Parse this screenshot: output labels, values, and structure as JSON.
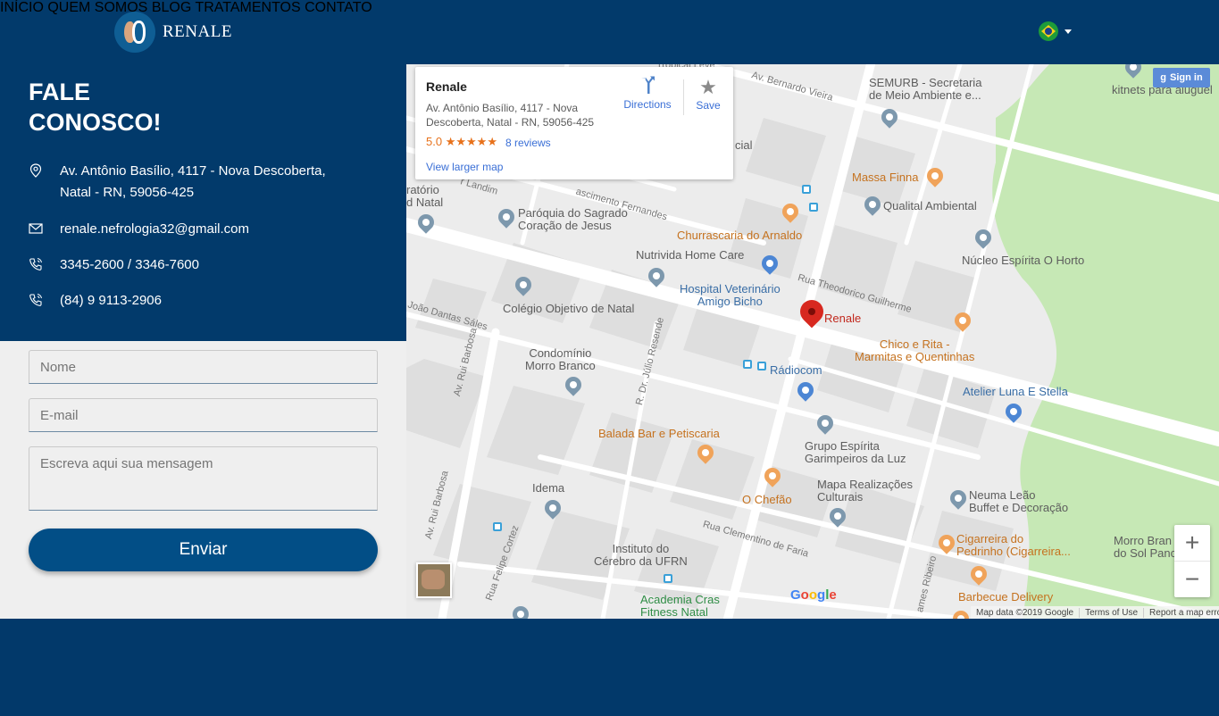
{
  "brand": {
    "name": "RENALE"
  },
  "nav": {
    "items": [
      {
        "label": "INÍCIO"
      },
      {
        "label": "QUEM SOMOS"
      },
      {
        "label": "BLOG"
      },
      {
        "label": "TRATAMENTOS"
      },
      {
        "label": "CONTATO"
      }
    ],
    "language_icon": "brazil-flag-icon"
  },
  "contact": {
    "title_line1": "FALE",
    "title_line2": "CONOSCO!",
    "address_line1": "Av. Antônio Basílio, 4117 - Nova Descoberta,",
    "address_line2": "Natal - RN, 59056-425",
    "email": "renale.nefrologia32@gmail.com",
    "phone1": "3345-2600 / 3346-7600",
    "phone2": "(84) 9 9113-2906"
  },
  "form": {
    "name_placeholder": "Nome",
    "email_placeholder": "E-mail",
    "message_placeholder": "Escreva aqui sua mensagem",
    "submit_label": "Enviar"
  },
  "map": {
    "card": {
      "name": "Renale",
      "address_line1": "Av. Antônio Basílio, 4117 - Nova",
      "address_line2": "Descoberta, Natal - RN, 59056-425",
      "rating": "5.0",
      "reviews": "8 reviews",
      "larger_map": "View larger map",
      "directions": "Directions",
      "save": "Save"
    },
    "signin": "Sign in",
    "marker_label": "Renale",
    "places": {
      "semurb": "SEMURB - Secretaria",
      "semurb2": "de Meio Ambiente e...",
      "kitnets": "kitnets para aluguel",
      "massa": "Massa Finna",
      "qualital": "Qualital Ambiental",
      "paroquia": "Paróquia do Sagrado",
      "paroquia2": "Coração de Jesus",
      "churrascaria": "Churrascaria do Arnaldo",
      "nucleo": "Núcleo Espírita O Horto",
      "nutrivida": "Nutrivida Home Care",
      "hospital": "Hospital Veterinário",
      "hospital2": "Amigo Bicho",
      "colegio": "Colégio Objetivo de Natal",
      "chico": "Chico e Rita -",
      "chico2": "Marmitas e Quentinhas",
      "condominio": "Condomínio",
      "condominio2": "Morro Branco",
      "radiocom": "Rádiocom",
      "atelier": "Atelier Luna E Stella",
      "balada": "Balada Bar e Petiscaria",
      "grupo": "Grupo Espírita",
      "grupo2": "Garimpeiros da Luz",
      "idema": "Idema",
      "chefao": "O Chefão",
      "mapa": "Mapa Realizações",
      "mapa2": "Culturais",
      "neuma": "Neuma Leão",
      "neuma2": "Buffet e Decoração",
      "instituto": "Instituto do",
      "instituto2": "Cérebro da UFRN",
      "cigarreira": "Cigarreira do",
      "cigarreira2": "Pedrinho (Cigarreira...",
      "morro": "Morro Bran",
      "morro2": "do Sol Panc",
      "academia": "Academia Cras",
      "academia2": "Fitness Natal",
      "barbecue": "Barbecue Delivery",
      "partial_top": "Tropical Leve",
      "partial_ratorio": "ratório",
      "partial_dnatal": "d Natal",
      "partial_cial": "cial"
    },
    "streets": {
      "bernardo": "Av. Bernardo Vieira",
      "theodorico": "Rua Theodorico Guilherme",
      "ruibarbosa1": "Av. Rui Barbosa",
      "ruibarbosa2": "Av. Rui Barbosa",
      "julio": "R. Dr. Júlio Resende",
      "clementino": "Rua Clementino de Faria",
      "felipe": "Rua Felipe Cortez",
      "joaodantas": "João Dantas Sáles",
      "landim": "r Landim",
      "nascimento": "ascimento Fernandes",
      "ribeiro": "ames Ribeiro"
    },
    "google": "Google",
    "footer": {
      "data": "Map data ©2019 Google",
      "terms": "Terms of Use",
      "report": "Report a map error"
    }
  },
  "colors": {
    "primary": "#023a6b",
    "button": "#024e86",
    "form_bg": "#efefef"
  }
}
